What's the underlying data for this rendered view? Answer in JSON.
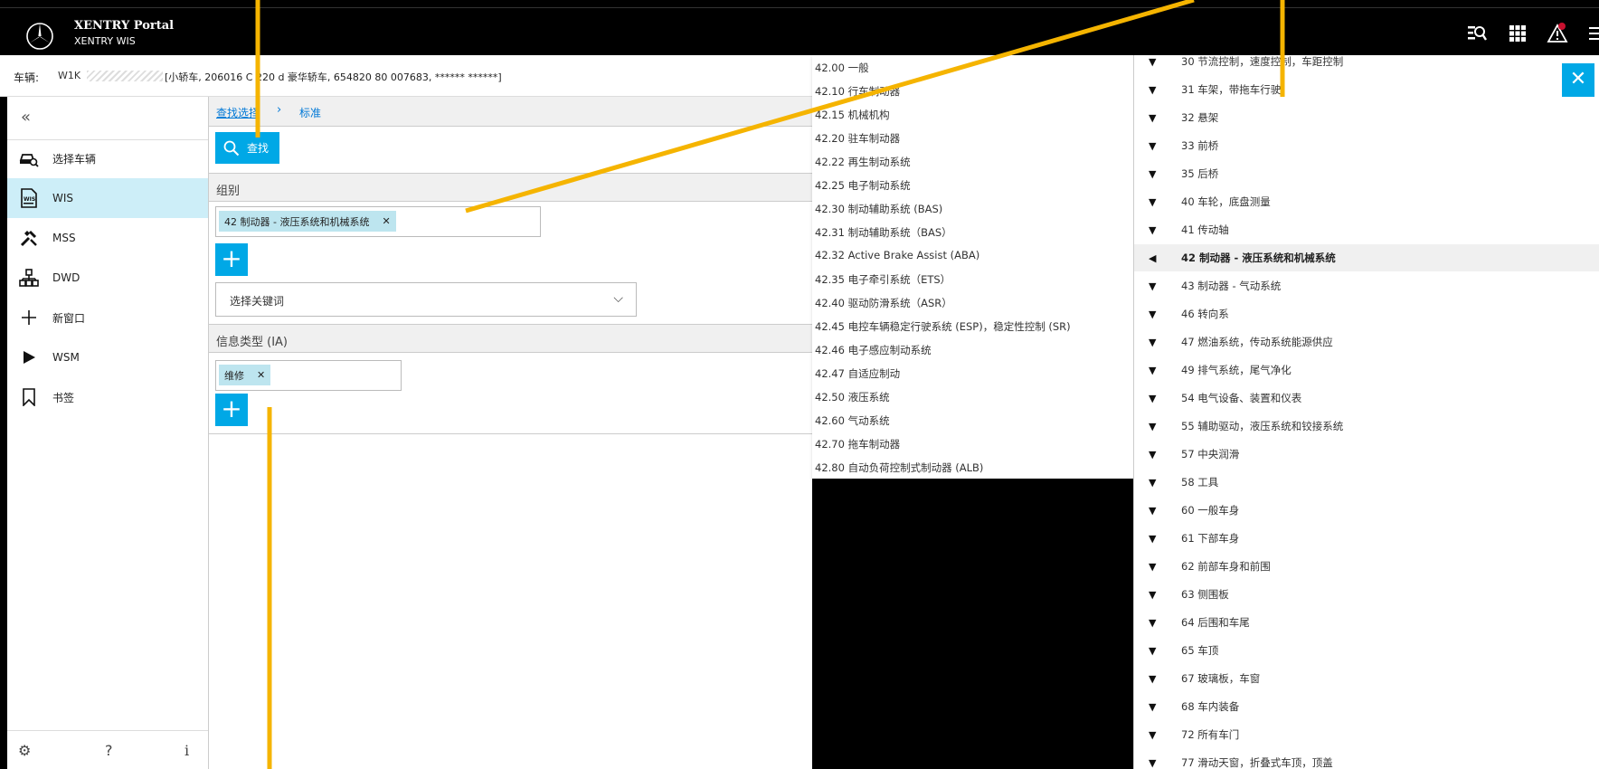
{
  "header": {
    "portal_title": "XENTRY Portal",
    "portal_subtitle": "XENTRY WIS"
  },
  "vehicle": {
    "label": "车辆:",
    "vin_prefix": "W1K",
    "info": "[小轿车, 206016 C 220 d 豪华轿车, 654820 80 007683, ****** ******]"
  },
  "sidebar": {
    "items": [
      {
        "label": "选择车辆",
        "icon": "car-search-icon"
      },
      {
        "label": "WIS",
        "icon": "wis-document-icon"
      },
      {
        "label": "MSS",
        "icon": "tools-icon"
      },
      {
        "label": "DWD",
        "icon": "network-icon"
      },
      {
        "label": "新窗口",
        "icon": "plus-icon"
      },
      {
        "label": "WSM",
        "icon": "play-icon"
      },
      {
        "label": "书签",
        "icon": "bookmark-icon"
      }
    ],
    "active": "WIS",
    "footer": {
      "settings": "⚙",
      "help": "?",
      "info": "i"
    }
  },
  "main": {
    "breadcrumb": {
      "link": "查找选择",
      "separator": "›",
      "current": "标准"
    },
    "search_button": "查找",
    "group_section": {
      "title": "组别",
      "chip": "42 制动器 - 液压系统和机械系统"
    },
    "keyword_select": {
      "value": "选择关键词"
    },
    "info_type_section": {
      "title": "信息类型 (IA)",
      "chip": "维修"
    }
  },
  "subgroups": [
    "42.00 一般",
    "42.10 行车制动器",
    "42.15 机械机构",
    "42.20 驻车制动器",
    "42.22 再生制动系统",
    "42.25 电子制动系统",
    "42.30 制动辅助系统 (BAS)",
    "42.31 制动辅助系统（BAS）",
    "42.32 Active Brake Assist (ABA)",
    "42.35 电子牵引系统（ETS）",
    "42.40 驱动防滑系统（ASR）",
    "42.45 电控车辆稳定行驶系统 (ESP)，稳定性控制 (SR)",
    "42.46 电子感应制动系统",
    "42.47 自适应制动",
    "42.50 液压系统",
    "42.60 气动系统",
    "42.70 拖车制动器",
    "42.80 自动负荷控制式制动器 (ALB)"
  ],
  "groups": [
    "30 节流控制，速度控制，车距控制",
    "31 车架，带拖车行驶",
    "32 悬架",
    "33 前桥",
    "35 后桥",
    "40 车轮，底盘测量",
    "41 传动轴",
    "42 制动器 - 液压系统和机械系统",
    "43 制动器 - 气动系统",
    "46 转向系",
    "47 燃油系统，传动系统能源供应",
    "49 排气系统，尾气净化",
    "54 电气设备、装置和仪表",
    "55 辅助驱动，液压系统和铰接系统",
    "57 中央润滑",
    "58 工具",
    "60 一般车身",
    "61 下部车身",
    "62 前部车身和前围",
    "63 侧围板",
    "64 后围和车尾",
    "65 车顶",
    "67 玻璃板，车窗",
    "68 车内装备",
    "72 所有车门",
    "77 滑动天窗，折叠式车顶，顶盖"
  ],
  "selected_group_index": 7,
  "colors": {
    "accent": "#00a8e6",
    "annotation": "#f5b400",
    "chip_bg": "#bde5ef",
    "active_nav": "#cdeef8"
  }
}
